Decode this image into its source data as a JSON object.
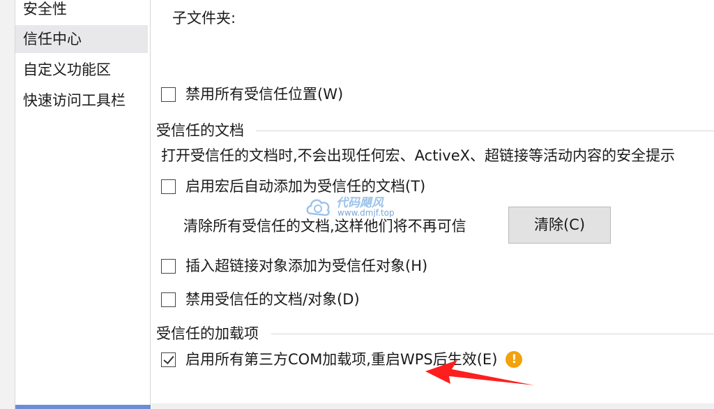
{
  "sidebar": {
    "items": [
      {
        "label": "安全性"
      },
      {
        "label": "信任中心"
      },
      {
        "label": "自定义功能区"
      },
      {
        "label": "快速访问工具栏"
      }
    ]
  },
  "main": {
    "subfolder_label": "子文件夹:",
    "disable_all_locations_label": "禁用所有受信任位置(W)",
    "trusted_docs": {
      "title": "受信任的文档",
      "description": "打开受信任的文档时,不会出现任何宏、ActiveX、超链接等活动内容的安全提示",
      "auto_add_after_macro_label": "启用宏后自动添加为受信任的文档(T)",
      "clear_description": "清除所有受信任的文档,这样他们将不再可信",
      "clear_button_label": "清除(C)",
      "insert_hyperlink_label": "插入超链接对象添加为受信任对象(H)",
      "disable_trusted_label": "禁用受信任的文档/对象(D)"
    },
    "trusted_addins": {
      "title": "受信任的加载项",
      "enable_com_label": "启用所有第三方COM加载项,重启WPS后生效(E)",
      "warning_symbol": "!"
    }
  },
  "watermark": {
    "title": "代码飓风",
    "url": "www.dmjf.top"
  },
  "colors": {
    "accent_bar": "#6a8ed6",
    "sidebar_active": "#e8e8ea",
    "warning": "#f2a20c",
    "annotation_arrow": "#ff1e1e"
  }
}
